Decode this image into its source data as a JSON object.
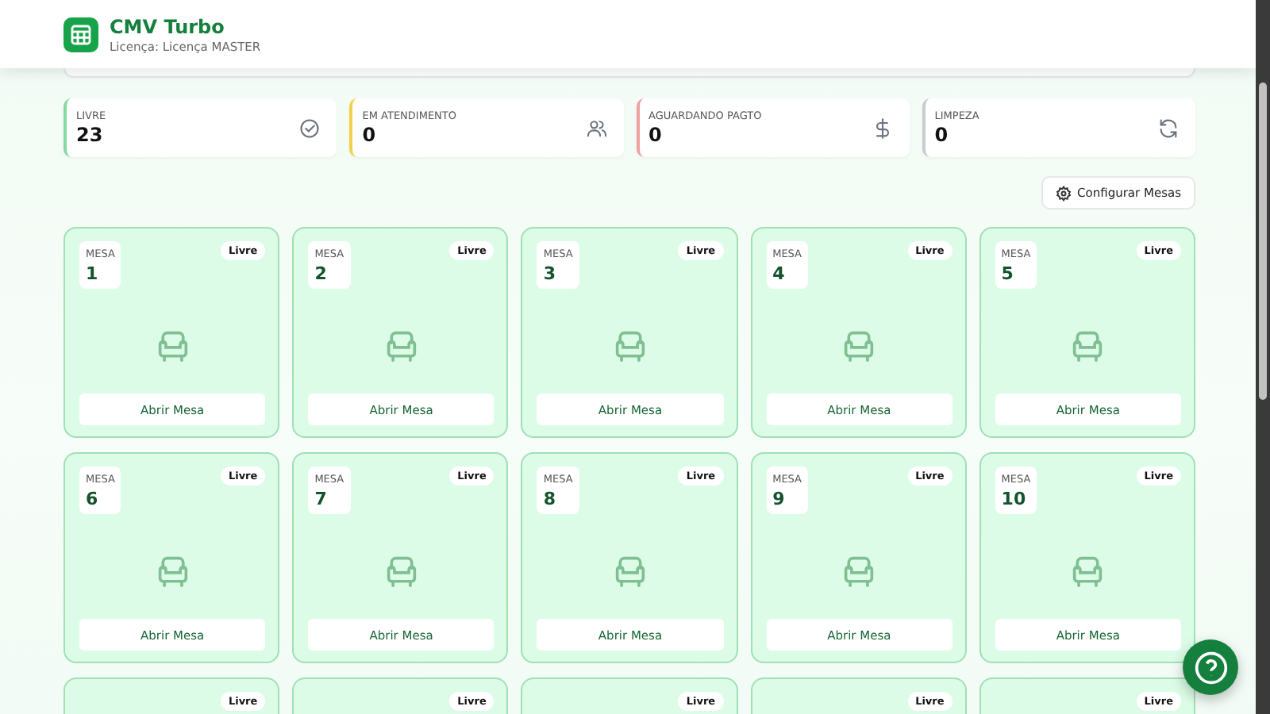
{
  "header": {
    "title": "CMV Turbo",
    "subtitle": "Licença: Licença MASTER"
  },
  "stats": [
    {
      "kind": "check",
      "label": "LIVRE",
      "value": "23",
      "color": "#86d9a0"
    },
    {
      "kind": "users",
      "label": "EM ATENDIMENTO",
      "value": "0",
      "color": "#f2d14a"
    },
    {
      "kind": "money",
      "label": "AGUARDANDO PAGTO",
      "value": "0",
      "color": "#f0a0a0"
    },
    {
      "kind": "refresh",
      "label": "LIMPEZA",
      "value": "0",
      "color": "#c9ccd3"
    }
  ],
  "config_button": "Configurar Mesas",
  "tables": [
    {
      "label": "MESA",
      "number": "1",
      "status": "Livre",
      "button": "Abrir Mesa"
    },
    {
      "label": "MESA",
      "number": "2",
      "status": "Livre",
      "button": "Abrir Mesa"
    },
    {
      "label": "MESA",
      "number": "3",
      "status": "Livre",
      "button": "Abrir Mesa"
    },
    {
      "label": "MESA",
      "number": "4",
      "status": "Livre",
      "button": "Abrir Mesa"
    },
    {
      "label": "MESA",
      "number": "5",
      "status": "Livre",
      "button": "Abrir Mesa"
    },
    {
      "label": "MESA",
      "number": "6",
      "status": "Livre",
      "button": "Abrir Mesa"
    },
    {
      "label": "MESA",
      "number": "7",
      "status": "Livre",
      "button": "Abrir Mesa"
    },
    {
      "label": "MESA",
      "number": "8",
      "status": "Livre",
      "button": "Abrir Mesa"
    },
    {
      "label": "MESA",
      "number": "9",
      "status": "Livre",
      "button": "Abrir Mesa"
    },
    {
      "label": "MESA",
      "number": "10",
      "status": "Livre",
      "button": "Abrir Mesa"
    },
    {
      "status": "Livre"
    },
    {
      "status": "Livre"
    },
    {
      "status": "Livre"
    },
    {
      "status": "Livre"
    },
    {
      "status": "Livre"
    }
  ]
}
